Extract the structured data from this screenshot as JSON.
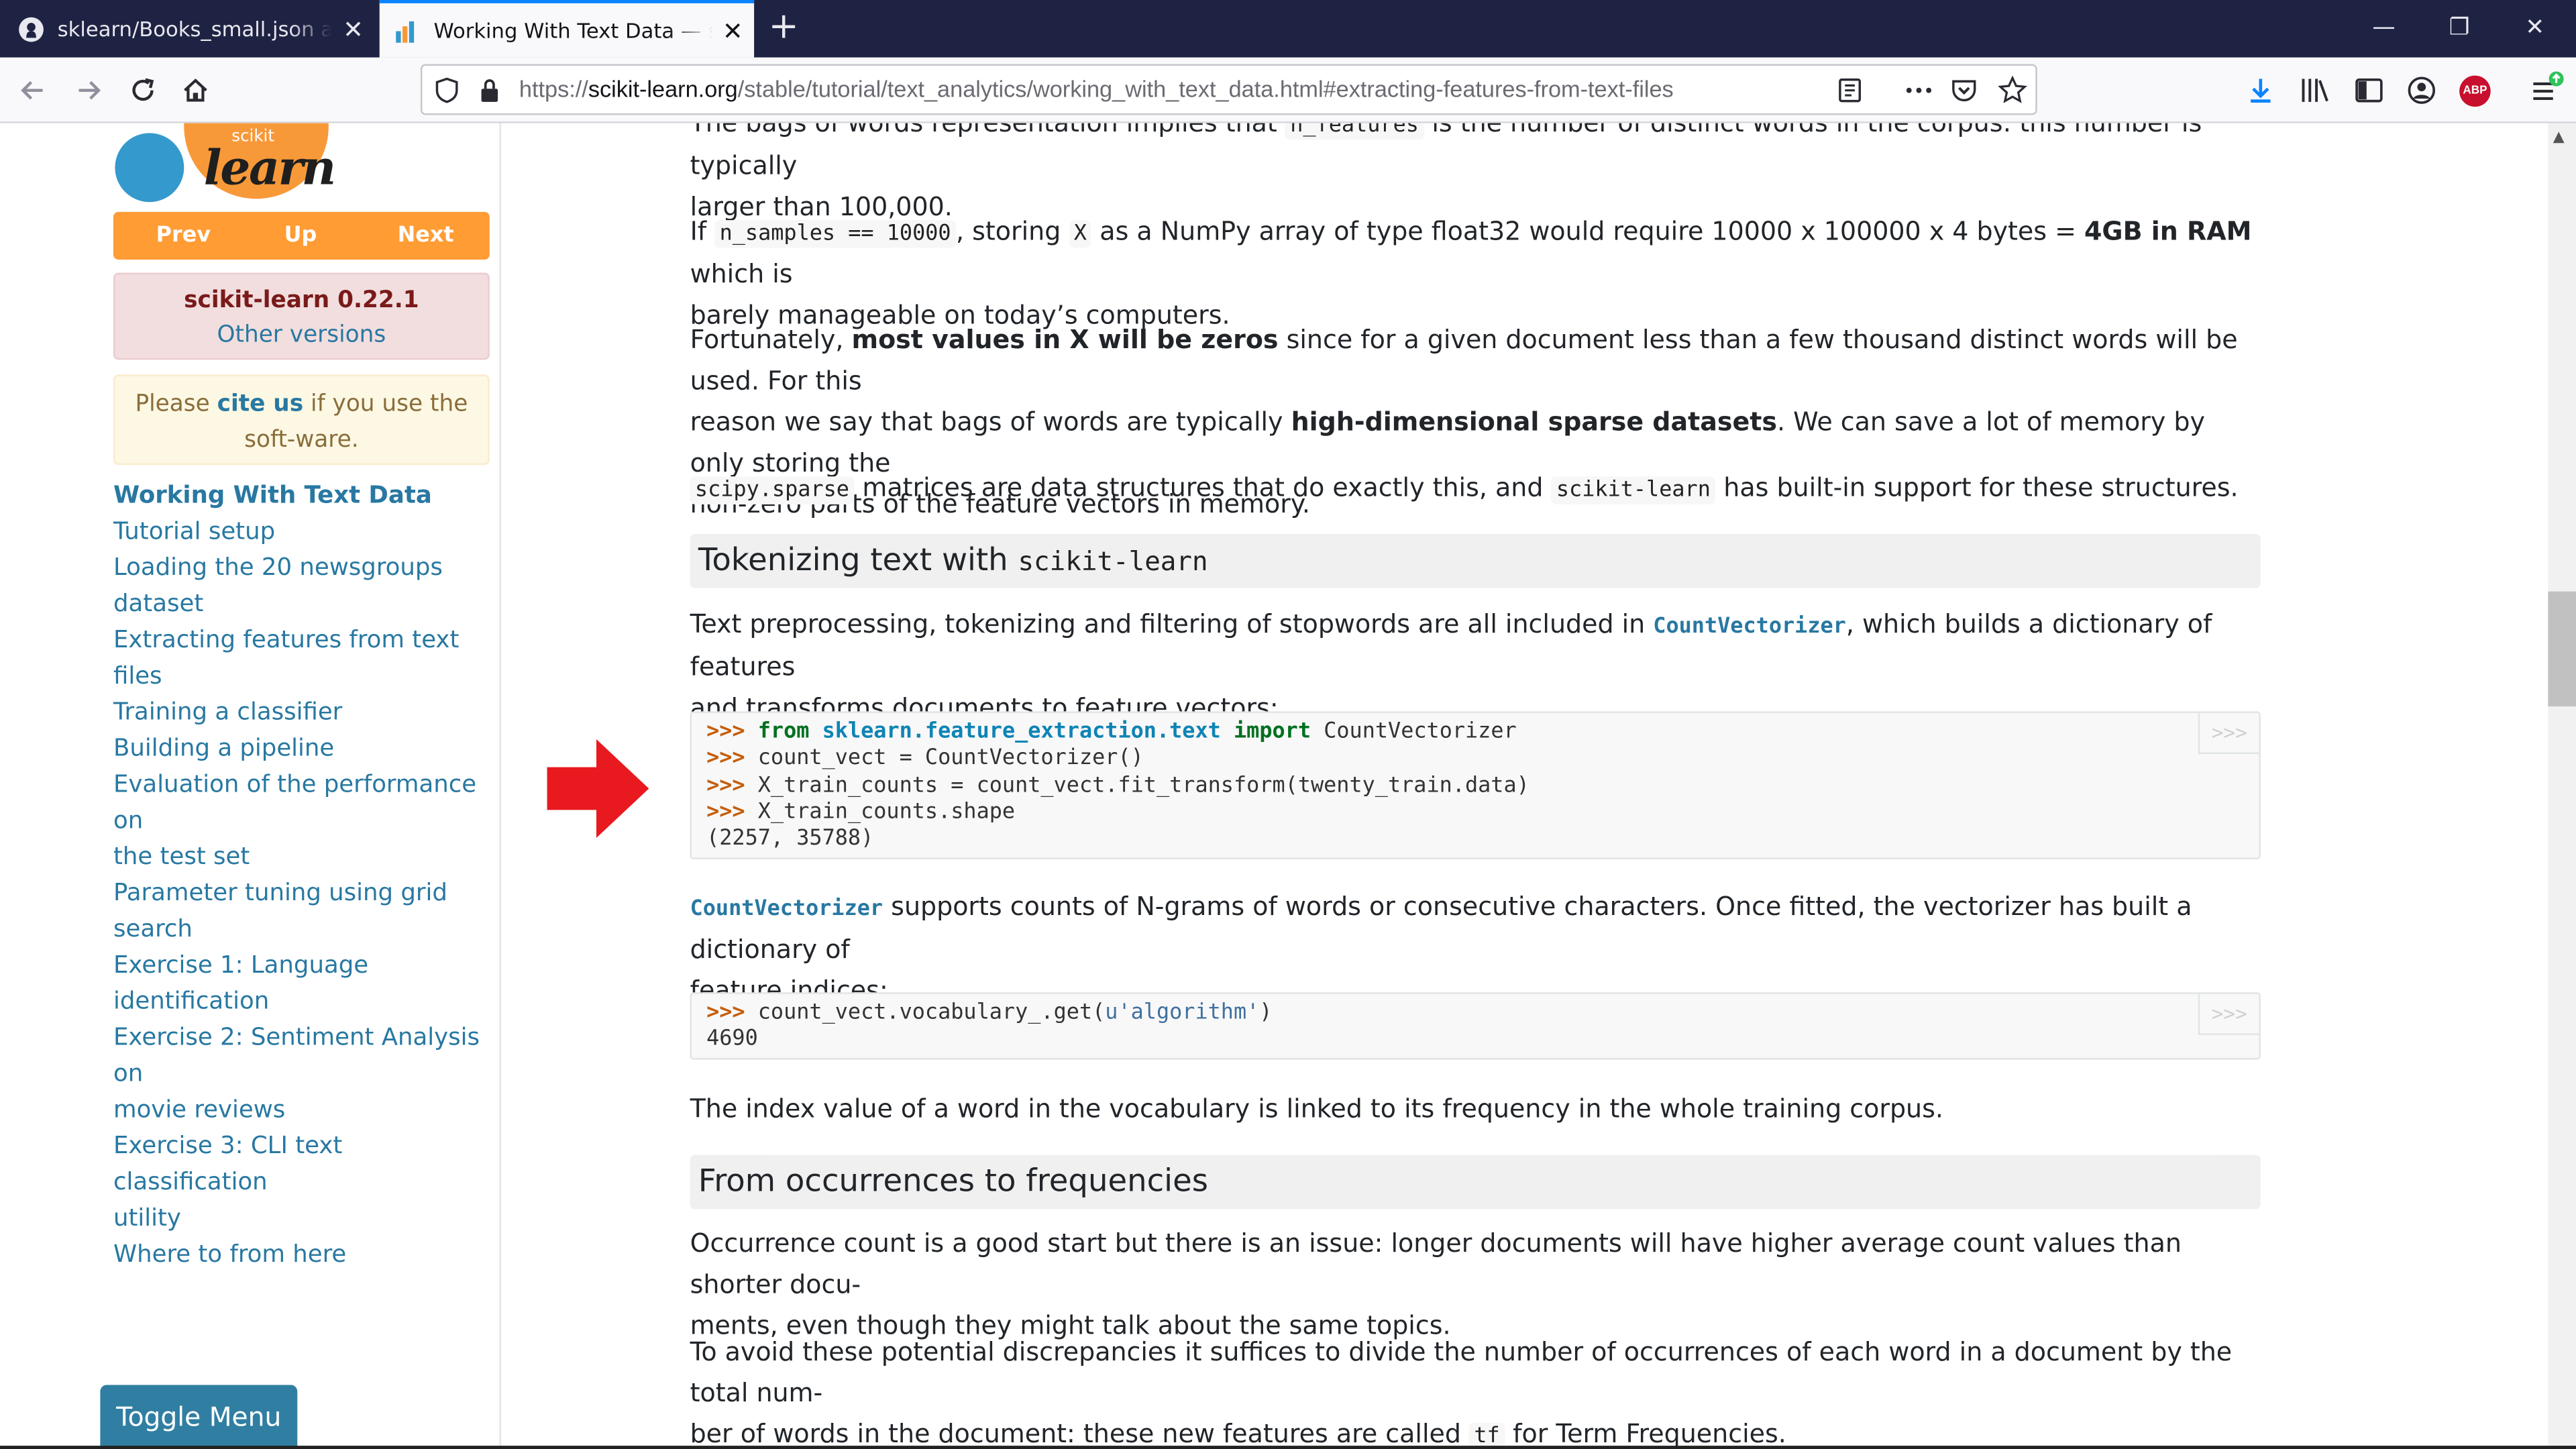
{
  "browser": {
    "tabs": [
      {
        "title": "sklearn/Books_small.json at master",
        "active": false
      },
      {
        "title": "Working With Text Data — scikit-learn",
        "active": true
      }
    ],
    "url_prefix": "https://",
    "url_domain": "scikit-learn.org",
    "url_path": "/stable/tutorial/text_analytics/working_with_text_data.html#extracting-features-from-text-files"
  },
  "sidebar": {
    "logo_small": "scikit",
    "logo_big": "learn",
    "nav": {
      "prev": "Prev",
      "up": "Up",
      "next": "Next"
    },
    "version": "scikit-learn 0.22.1",
    "other_versions": "Other versions",
    "cite_pre": "Please ",
    "cite_link": "cite us",
    "cite_post": " if you use the soft-ware.",
    "toc_head": "Working With Text Data",
    "toc": [
      "Tutorial setup",
      "Loading the 20 newsgroups",
      "dataset",
      "Extracting features from text files",
      "Training a classifier",
      "Building a pipeline",
      "Evaluation of the performance on",
      "the test set",
      "Parameter tuning using grid search",
      "Exercise 1: Language identification",
      "Exercise 2: Sentiment Analysis on",
      "movie reviews",
      "Exercise 3: CLI text classification",
      "utility",
      "Where to from here"
    ],
    "toggle_menu": "Toggle Menu"
  },
  "content": {
    "p0_cut": "The bags of words representation implies that ",
    "p0_code": "n_features",
    "p0_cut2": " is the number of distinct words in the corpus: this number is typically",
    "p0_line2": "larger than 100,000.",
    "p1_a": "If ",
    "p1_code1": "n_samples == 10000",
    "p1_b": ", storing ",
    "p1_code2": "X",
    "p1_c": " as a NumPy array of type float32 would require 10000 x 100000 x 4 bytes = ",
    "p1_bold": "4GB in RAM",
    "p1_d": " which is",
    "p1_line2": "barely manageable on today’s computers.",
    "p2_a": "Fortunately, ",
    "p2_bold1": "most values in X will be zeros",
    "p2_b": " since for a given document less than a few thousand distinct words will be used. For this",
    "p2_c": "reason we say that bags of words are typically ",
    "p2_bold2": "high-dimensional sparse datasets",
    "p2_d": ". We can save a lot of memory by only storing the",
    "p2_line3": "non-zero parts of the feature vectors in memory.",
    "p3_code1": "scipy.sparse",
    "p3_a": " matrices are data structures that do exactly this, and ",
    "p3_code2": "scikit-learn",
    "p3_b": " has built-in support for these structures.",
    "h_tokenizing": "Tokenizing text with ",
    "h_tokenizing_code": "scikit-learn",
    "p4_a": "Text preprocessing, tokenizing and filtering of stopwords are all included in ",
    "p4_link": "CountVectorizer",
    "p4_b": ", which builds a dictionary of features",
    "p4_line2": "and transforms documents to feature vectors:",
    "code1": {
      "prompt": ">>>",
      "l1_kw1": "from",
      "l1_mod": "sklearn.feature_extraction.text",
      "l1_kw2": "import",
      "l1_rest": " CountVectorizer",
      "l2": " count_vect = CountVectorizer()",
      "l3": " X_train_counts = count_vect.fit_transform(twenty_train.data)",
      "l4": " X_train_counts.shape",
      "out": "(2257, 35788)"
    },
    "p5_link": "CountVectorizer",
    "p5_a": " supports counts of N-grams of words or consecutive characters. Once fitted, the vectorizer has built a dictionary of",
    "p5_line2": "feature indices:",
    "code2": {
      "l1_a": " count_vect.vocabulary_.get(",
      "l1_str": "u'algorithm'",
      "l1_b": ")",
      "out": "4690"
    },
    "copy_label": ">>>",
    "p6": "The index value of a word in the vocabulary is linked to its frequency in the whole training corpus.",
    "h_occurrences": "From occurrences to frequencies",
    "p7_line1": "Occurrence count is a good start but there is an issue: longer documents will have higher average count values than shorter docu-",
    "p7_line2": "ments, even though they might talk about the same topics.",
    "p8_line1": "To avoid these potential discrepancies it suffices to divide the number of occurrences of each word in a document by the total num-",
    "p8_a": "ber of words in the document: these new features are called ",
    "p8_code": "tf",
    "p8_b": " for Term Frequencies."
  },
  "colors": {
    "accent": "#ff9c34",
    "link": "#2878a2",
    "arrow": "#e8191f",
    "tabstrip": "#1f2343"
  }
}
